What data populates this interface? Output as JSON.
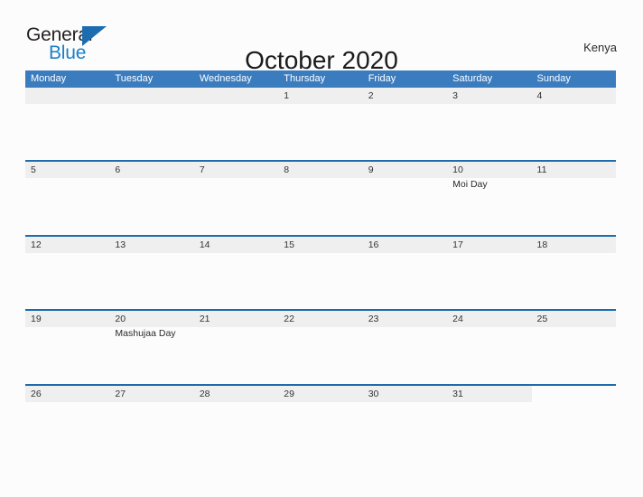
{
  "brand": {
    "name_part1": "General",
    "name_part2": "Blue",
    "triangle_icon": "triangle-icon",
    "accent_color": "#1c7fc4"
  },
  "header": {
    "title": "October 2020",
    "country": "Kenya"
  },
  "theme": {
    "header_blue": "#3b7cbf",
    "rule_blue": "#1f6cac",
    "band_gray": "#efefef",
    "page_background": "#fcfcfd"
  },
  "calendar": {
    "weekday_headers": [
      "Monday",
      "Tuesday",
      "Wednesday",
      "Thursday",
      "Friday",
      "Saturday",
      "Sunday"
    ],
    "weeks": [
      {
        "band_columns": 7,
        "days": [
          {
            "num": "",
            "event": ""
          },
          {
            "num": "",
            "event": ""
          },
          {
            "num": "",
            "event": ""
          },
          {
            "num": "1",
            "event": ""
          },
          {
            "num": "2",
            "event": ""
          },
          {
            "num": "3",
            "event": ""
          },
          {
            "num": "4",
            "event": ""
          }
        ]
      },
      {
        "band_columns": 7,
        "days": [
          {
            "num": "5",
            "event": ""
          },
          {
            "num": "6",
            "event": ""
          },
          {
            "num": "7",
            "event": ""
          },
          {
            "num": "8",
            "event": ""
          },
          {
            "num": "9",
            "event": ""
          },
          {
            "num": "10",
            "event": "Moi Day"
          },
          {
            "num": "11",
            "event": ""
          }
        ]
      },
      {
        "band_columns": 7,
        "days": [
          {
            "num": "12",
            "event": ""
          },
          {
            "num": "13",
            "event": ""
          },
          {
            "num": "14",
            "event": ""
          },
          {
            "num": "15",
            "event": ""
          },
          {
            "num": "16",
            "event": ""
          },
          {
            "num": "17",
            "event": ""
          },
          {
            "num": "18",
            "event": ""
          }
        ]
      },
      {
        "band_columns": 7,
        "days": [
          {
            "num": "19",
            "event": ""
          },
          {
            "num": "20",
            "event": "Mashujaa Day"
          },
          {
            "num": "21",
            "event": ""
          },
          {
            "num": "22",
            "event": ""
          },
          {
            "num": "23",
            "event": ""
          },
          {
            "num": "24",
            "event": ""
          },
          {
            "num": "25",
            "event": ""
          }
        ]
      },
      {
        "band_columns": 6,
        "days": [
          {
            "num": "26",
            "event": ""
          },
          {
            "num": "27",
            "event": ""
          },
          {
            "num": "28",
            "event": ""
          },
          {
            "num": "29",
            "event": ""
          },
          {
            "num": "30",
            "event": ""
          },
          {
            "num": "31",
            "event": ""
          },
          {
            "num": "",
            "event": ""
          }
        ]
      }
    ]
  }
}
